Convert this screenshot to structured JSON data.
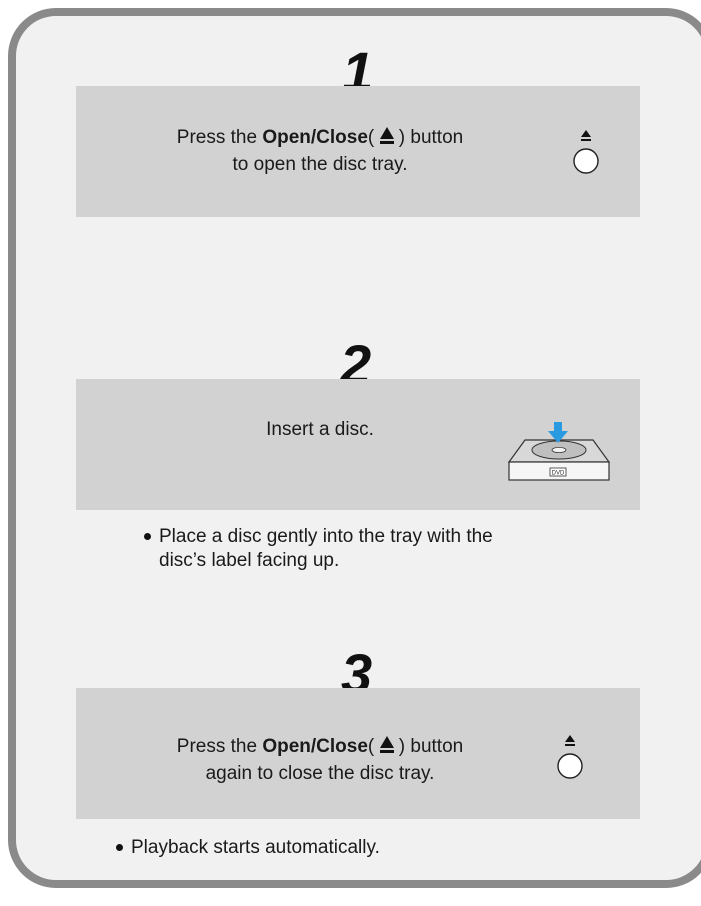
{
  "steps": [
    {
      "number": "1",
      "line1_prefix": "Press the ",
      "line1_bold": "Open/Close",
      "line1_open_paren": "( ",
      "line1_suffix": " ) button",
      "line2": "to open the disc tray.",
      "icon": "eject-button-icon"
    },
    {
      "number": "2",
      "text": "Insert a disc.",
      "icon": "disc-tray-insert-icon",
      "note": "Place a disc gently into the tray with the disc’s label facing up.",
      "note_line1": "Place a disc gently into the tray with the",
      "note_line2": "disc’s label facing up.",
      "tray_label": "DVD"
    },
    {
      "number": "3",
      "line1_prefix": "Press the ",
      "line1_bold": "Open/Close",
      "line1_open_paren": "( ",
      "line1_suffix": " ) button",
      "line2": "again to close the disc tray.",
      "icon": "eject-button-icon",
      "note": "Playback starts automatically."
    }
  ],
  "colors": {
    "frame_border": "#8a8a8a",
    "frame_fill": "#f1f1f1",
    "step_box": "#d2d2d2",
    "arrow": "#2a9be0"
  }
}
